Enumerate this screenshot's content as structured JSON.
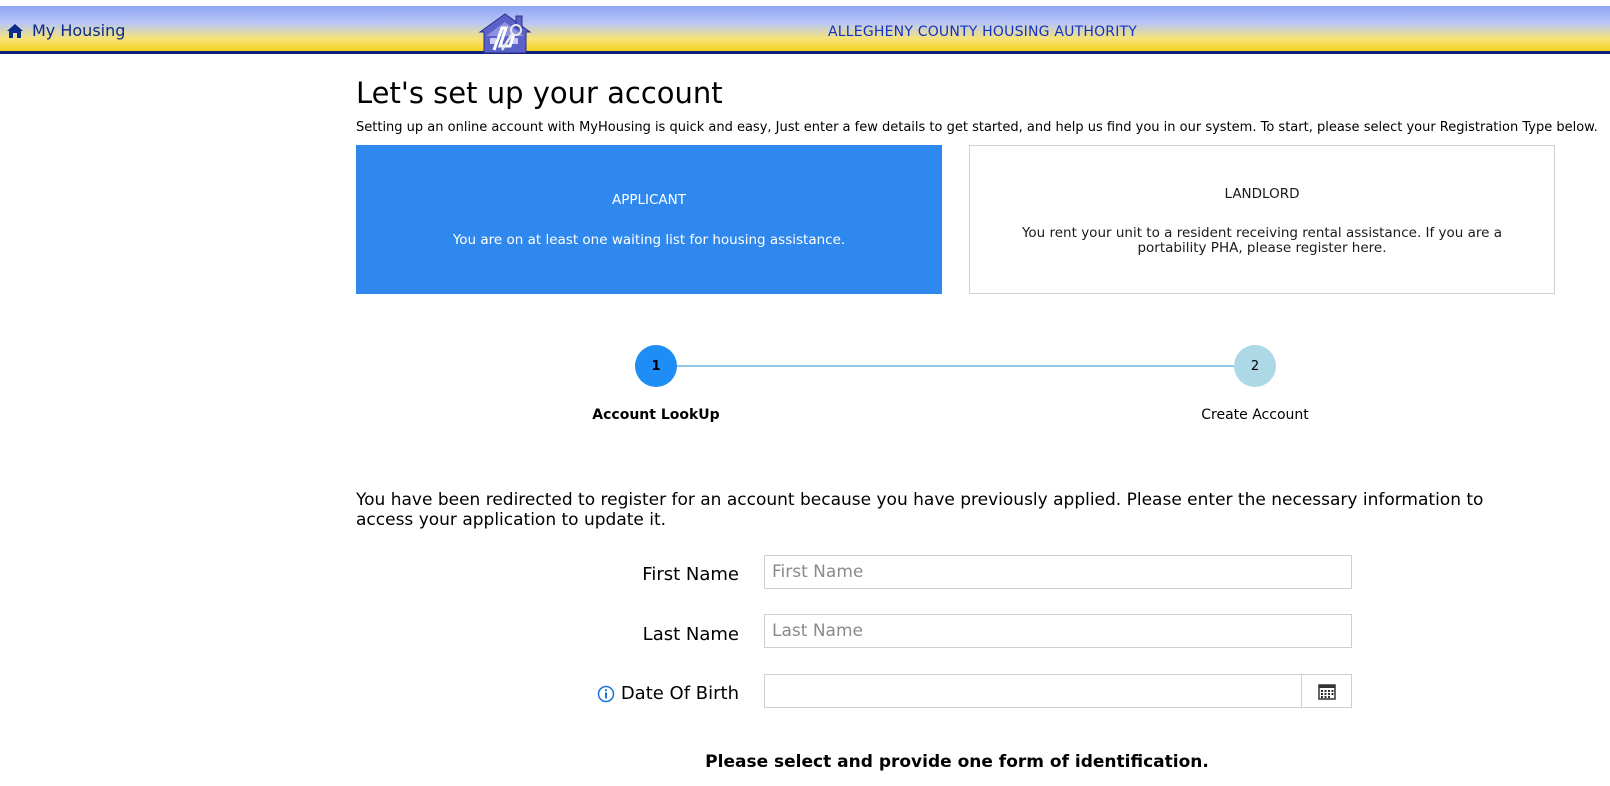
{
  "header": {
    "home_label": "My Housing",
    "org_name": "ALLEGHENY COUNTY HOUSING AUTHORITY",
    "home_icon": "home-icon",
    "logo": "housing-authority-logo"
  },
  "page": {
    "title": "Let's set up your account",
    "intro": "Setting up an online account with MyHousing is quick and easy, Just enter a few details to get started, and help us find you in our system. To start, please select your Registration Type below."
  },
  "registration_types": {
    "applicant": {
      "title": "APPLICANT",
      "description": "You are on at least one waiting list for housing assistance."
    },
    "landlord": {
      "title": "LANDLORD",
      "description": "You rent your unit to a resident receiving rental assistance. If you are a portability PHA, please register here."
    }
  },
  "stepper": {
    "steps": [
      {
        "number": "1",
        "label": "Account LookUp",
        "active": true
      },
      {
        "number": "2",
        "label": "Create Account",
        "active": false
      }
    ]
  },
  "lookup": {
    "message": "You have been redirected to register for an account because you have previously applied. Please enter the necessary information to access your application to update it.",
    "first_name_label": "First Name",
    "first_name_placeholder": "First Name",
    "first_name_value": "",
    "last_name_label": "Last Name",
    "last_name_placeholder": "Last Name",
    "last_name_value": "",
    "dob_label": "Date Of Birth",
    "dob_value": "",
    "dob_info_icon": "info-icon",
    "calendar_icon": "calendar-icon",
    "id_prompt": "Please select and provide one form of identification."
  },
  "colors": {
    "accent_blue": "#2f88ee",
    "step_active": "#1e8df5",
    "step_inactive": "#add8e6",
    "header_text": "#1231c8"
  }
}
